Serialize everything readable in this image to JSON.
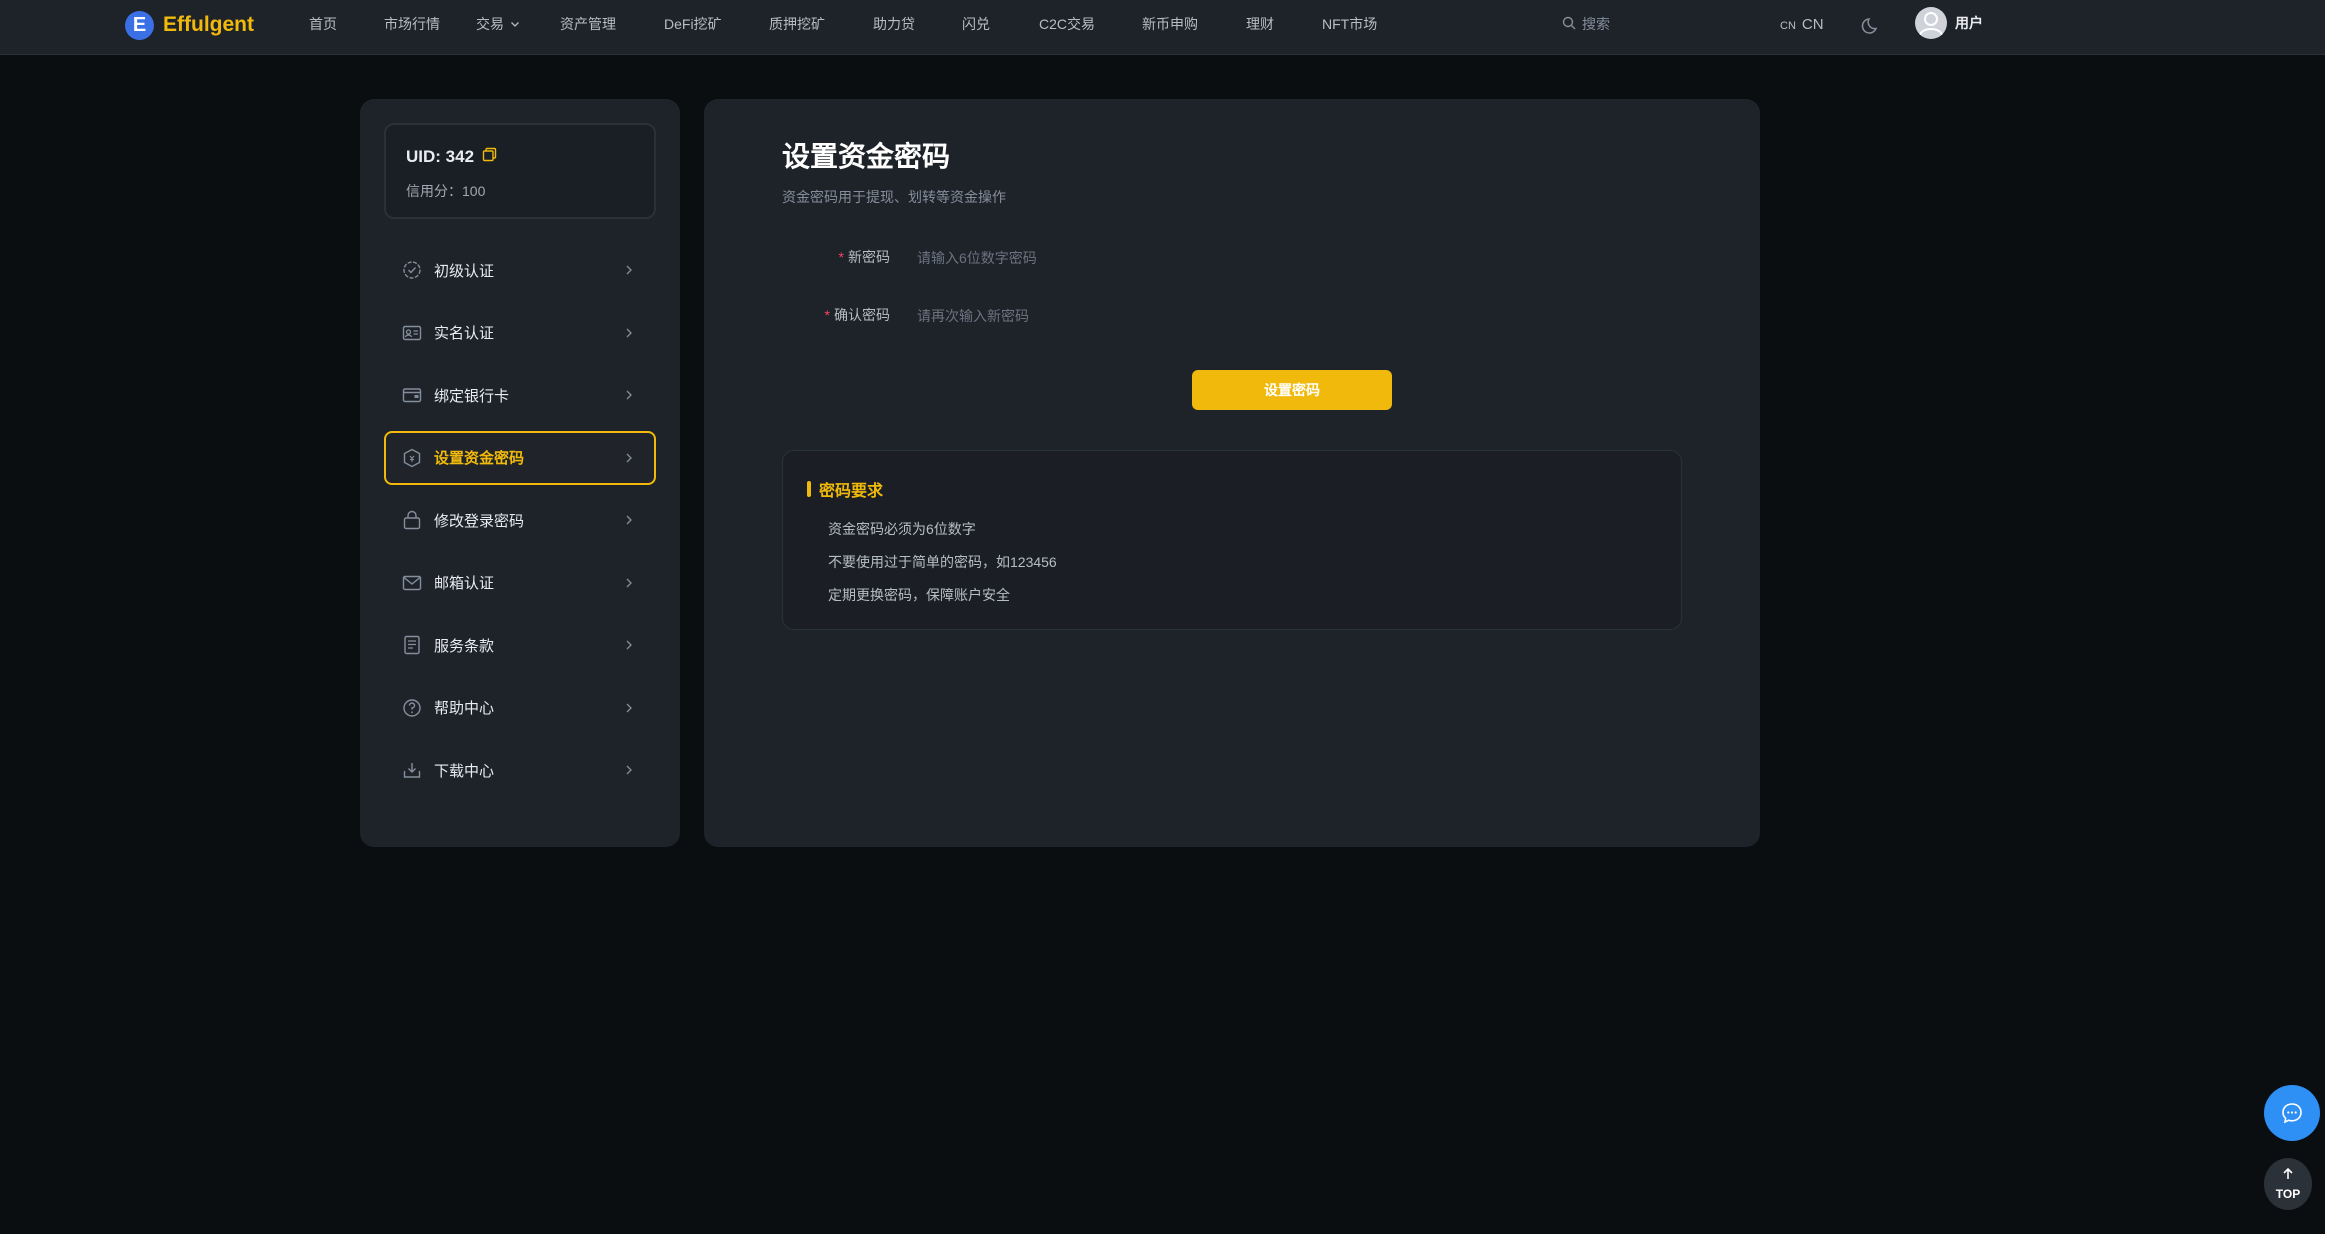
{
  "brand": {
    "mark": "E",
    "name": "Effulgent"
  },
  "nav": {
    "items": [
      "首页",
      "市场行情",
      "交易",
      "资产管理",
      "DeFi挖矿",
      "质押挖矿",
      "助力贷",
      "闪兑",
      "C2C交易",
      "新币申购",
      "理财",
      "NFT市场"
    ],
    "search_placeholder": "搜索",
    "lang_flag": "CN",
    "lang_code": "CN",
    "user_name": "用户"
  },
  "sidebar": {
    "uid": "UID: 342",
    "credit": "信用分：100",
    "items": [
      {
        "label": "初级认证",
        "icon": "badge-check-icon"
      },
      {
        "label": "实名认证",
        "icon": "id-card-icon"
      },
      {
        "label": "绑定银行卡",
        "icon": "wallet-icon"
      },
      {
        "label": "设置资金密码",
        "icon": "shield-icon",
        "active": true
      },
      {
        "label": "修改登录密码",
        "icon": "lock-icon"
      },
      {
        "label": "邮箱认证",
        "icon": "mail-icon"
      },
      {
        "label": "服务条款",
        "icon": "document-icon"
      },
      {
        "label": "帮助中心",
        "icon": "help-icon"
      },
      {
        "label": "下载中心",
        "icon": "download-icon"
      }
    ]
  },
  "main": {
    "title": "设置资金密码",
    "subtitle": "资金密码用于提现、划转等资金操作",
    "fields": {
      "new_password": {
        "label": "新密码",
        "placeholder": "请输入6位数字密码"
      },
      "confirm_password": {
        "label": "确认密码",
        "placeholder": "请再次输入新密码"
      }
    },
    "submit_label": "设置密码",
    "requirements": {
      "title": "密码要求",
      "items": [
        "资金密码必须为6位数字",
        "不要使用过于简单的密码，如123456",
        "定期更换密码，保障账户安全"
      ]
    }
  },
  "floating": {
    "top_label": "TOP"
  },
  "colors": {
    "accent": "#f0b90b",
    "bg": "#0b0e11",
    "panel": "#1e2329",
    "chat": "#2e8ff5"
  }
}
